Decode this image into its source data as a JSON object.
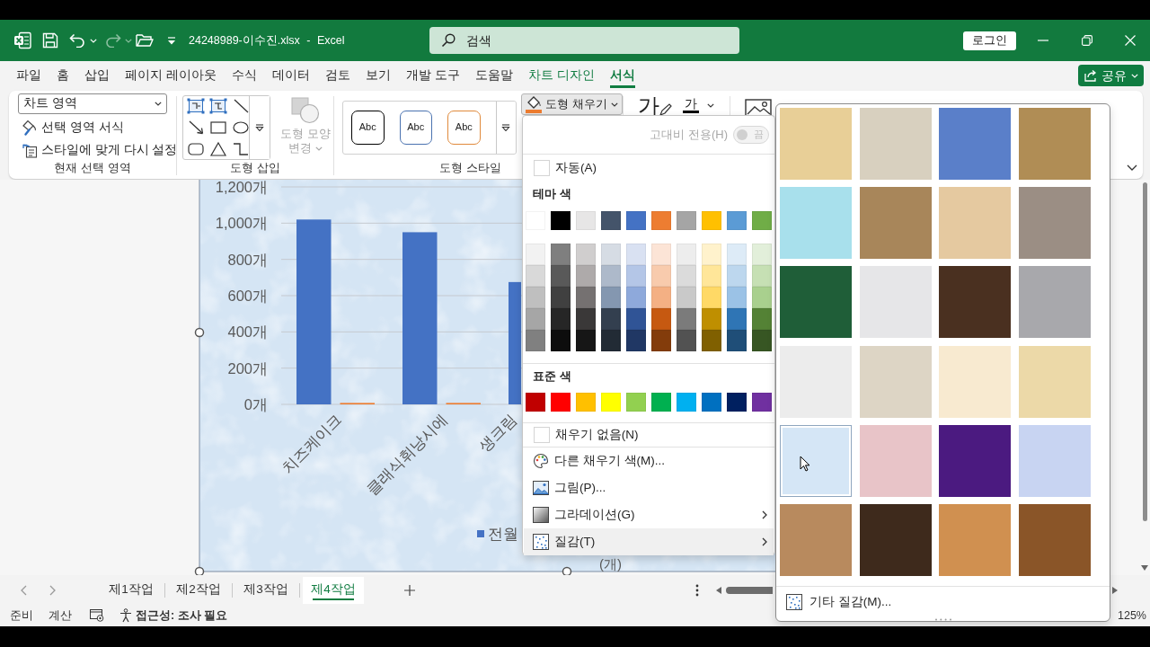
{
  "window": {
    "title": "24248989-이수진.xlsx - Excel",
    "search": {
      "placeholder": "검색"
    },
    "sign_in": "로그인"
  },
  "tabs": [
    {
      "label": "파일",
      "contextual": false,
      "selected": false
    },
    {
      "label": "홈",
      "contextual": false,
      "selected": false
    },
    {
      "label": "삽입",
      "contextual": false,
      "selected": false
    },
    {
      "label": "페이지 레이아웃",
      "contextual": false,
      "selected": false
    },
    {
      "label": "수식",
      "contextual": false,
      "selected": false
    },
    {
      "label": "데이터",
      "contextual": false,
      "selected": false
    },
    {
      "label": "검토",
      "contextual": false,
      "selected": false
    },
    {
      "label": "보기",
      "contextual": false,
      "selected": false
    },
    {
      "label": "개발 도구",
      "contextual": false,
      "selected": false
    },
    {
      "label": "도움말",
      "contextual": false,
      "selected": false
    },
    {
      "label": "차트 디자인",
      "contextual": true,
      "selected": false
    },
    {
      "label": "서식",
      "contextual": true,
      "selected": true
    }
  ],
  "share": "공유",
  "ribbon": {
    "current_selection": {
      "dropdown": "차트 영역",
      "buttons": [
        {
          "kind": "format",
          "label": "선택 영역 서식"
        },
        {
          "kind": "reset",
          "label": "스타일에 맞게 다시 설정"
        }
      ],
      "label": "현재 선택 영역"
    },
    "insert_shapes": {
      "change_shape": {
        "label": "도형 모양 변경",
        "disabled": true
      },
      "label": "도형 삽입"
    },
    "shape_styles": {
      "presets": [
        {
          "text": "Abc",
          "color": "#000000"
        },
        {
          "text": "Abc",
          "color": "#4a72b0"
        },
        {
          "text": "Abc",
          "color": "#e08a3c"
        }
      ],
      "label": "도형 스타일"
    },
    "shape_fill": {
      "label": "도형 채우기",
      "expanded": true
    },
    "wordart": {
      "quick_styles": "가",
      "text_fill": "가"
    }
  },
  "chart": {
    "chart_data": {
      "type": "bar",
      "categories": [
        "치즈케이크",
        "클래식휘낭시에",
        "생크림"
      ],
      "series": [
        {
          "name": "전월",
          "color": "#4472c4",
          "values": [
            1020,
            950,
            675
          ]
        },
        {
          "color": "#ed7d31",
          "values": [
            8,
            8,
            null
          ]
        }
      ],
      "ylim": [
        0,
        1200
      ],
      "yticks": [
        {
          "value": 0,
          "label": "0개"
        },
        {
          "value": 200,
          "label": "200개"
        },
        {
          "value": 400,
          "label": "400개"
        },
        {
          "value": 600,
          "label": "600개"
        },
        {
          "value": 800,
          "label": "800개"
        },
        {
          "value": 1000,
          "label": "1,000개"
        },
        {
          "value": 1200,
          "label": "1,200개"
        }
      ],
      "grid": true
    },
    "unit_label": "(개)"
  },
  "fill_menu": {
    "high_contrast": {
      "label": "고대비 전용(H)",
      "state_text": "끔",
      "on": false,
      "disabled": true
    },
    "automatic": "자동(A)",
    "theme_label": "테마 색",
    "theme_colors": [
      {
        "color": "#ffffff",
        "shades": [
          {
            "color": "#f2f2f2"
          },
          {
            "color": "#d9d9d9"
          },
          {
            "color": "#bfbfbf"
          },
          {
            "color": "#a6a6a6"
          },
          {
            "color": "#808080"
          }
        ]
      },
      {
        "color": "#000000",
        "shades": [
          {
            "color": "#7f7f7f"
          },
          {
            "color": "#595959"
          },
          {
            "color": "#404040"
          },
          {
            "color": "#262626"
          },
          {
            "color": "#0d0d0d"
          }
        ]
      },
      {
        "color": "#e7e6e6",
        "shades": [
          {
            "color": "#d0cece"
          },
          {
            "color": "#aeaaaa"
          },
          {
            "color": "#757171"
          },
          {
            "color": "#3a3838"
          },
          {
            "color": "#161616"
          }
        ]
      },
      {
        "color": "#44546a",
        "shades": [
          {
            "color": "#d6dce4"
          },
          {
            "color": "#adb9ca"
          },
          {
            "color": "#8497b0"
          },
          {
            "color": "#333f4f"
          },
          {
            "color": "#222b35"
          }
        ]
      },
      {
        "color": "#4472c4",
        "shades": [
          {
            "color": "#d9e1f2"
          },
          {
            "color": "#b4c6e7"
          },
          {
            "color": "#8ea9db"
          },
          {
            "color": "#305496"
          },
          {
            "color": "#203764"
          }
        ]
      },
      {
        "color": "#ed7d31",
        "shades": [
          {
            "color": "#fce4d6"
          },
          {
            "color": "#f8cbad"
          },
          {
            "color": "#f4b084"
          },
          {
            "color": "#c65911"
          },
          {
            "color": "#833c0b"
          }
        ]
      },
      {
        "color": "#a5a5a5",
        "shades": [
          {
            "color": "#ededed"
          },
          {
            "color": "#dbdbdb"
          },
          {
            "color": "#c9c9c9"
          },
          {
            "color": "#7b7b7b"
          },
          {
            "color": "#525252"
          }
        ]
      },
      {
        "color": "#ffc000",
        "shades": [
          {
            "color": "#fff2cc"
          },
          {
            "color": "#ffe699"
          },
          {
            "color": "#ffd966"
          },
          {
            "color": "#bf8f00"
          },
          {
            "color": "#806000"
          }
        ]
      },
      {
        "color": "#5b9bd5",
        "shades": [
          {
            "color": "#ddebf7"
          },
          {
            "color": "#bdd7ee"
          },
          {
            "color": "#9bc2e6"
          },
          {
            "color": "#2f75b5"
          },
          {
            "color": "#1f4e78"
          }
        ]
      },
      {
        "color": "#70ad47",
        "shades": [
          {
            "color": "#e2efda"
          },
          {
            "color": "#c6e0b4"
          },
          {
            "color": "#a9d08e"
          },
          {
            "color": "#548235"
          },
          {
            "color": "#375623"
          }
        ]
      }
    ],
    "standard_label": "표준 색",
    "standard_colors": [
      {
        "color": "#c00000"
      },
      {
        "color": "#ff0000"
      },
      {
        "color": "#ffc000"
      },
      {
        "color": "#ffff00"
      },
      {
        "color": "#92d050"
      },
      {
        "color": "#00b050"
      },
      {
        "color": "#00b0f0"
      },
      {
        "color": "#0070c0"
      },
      {
        "color": "#002060"
      },
      {
        "color": "#7030a0"
      }
    ],
    "items": [
      {
        "kind": "no_fill",
        "label": "채우기 없음(N)",
        "submenu": false,
        "selected": false
      },
      {
        "kind": "more_colors",
        "label": "다른 채우기 색(M)...",
        "submenu": false,
        "selected": false
      },
      {
        "kind": "picture",
        "label": "그림(P)...",
        "submenu": false,
        "selected": false
      },
      {
        "kind": "gradient",
        "label": "그라데이션(G)",
        "submenu": true,
        "selected": false
      },
      {
        "kind": "texture",
        "label": "질감(T)",
        "submenu": true,
        "selected": true
      }
    ]
  },
  "texture_gallery": {
    "tiles": [
      {
        "color": "#e8cf97",
        "selected": false
      },
      {
        "color": "#d8d0bf",
        "selected": false
      },
      {
        "color": "#5a7fc9",
        "selected": false
      },
      {
        "color": "#b08d55",
        "selected": false
      },
      {
        "color": "#a8e0ec",
        "selected": false
      },
      {
        "color": "#a8865a",
        "selected": false
      },
      {
        "color": "#e5c9a0",
        "selected": false
      },
      {
        "color": "#9b8e84",
        "selected": false
      },
      {
        "color": "#1f5e38",
        "selected": false
      },
      {
        "color": "#e6e6e8",
        "selected": false
      },
      {
        "color": "#4a3020",
        "selected": false
      },
      {
        "color": "#a8a8ac",
        "selected": false
      },
      {
        "color": "#ececec",
        "selected": false
      },
      {
        "color": "#ddd5c5",
        "selected": false
      },
      {
        "color": "#f8ead0",
        "selected": false
      },
      {
        "color": "#ecd9a8",
        "selected": false
      },
      {
        "color": "#d5e6f6",
        "selected": true
      },
      {
        "color": "#e8c4c8",
        "selected": false
      },
      {
        "color": "#4b1a80",
        "selected": false
      },
      {
        "color": "#c8d4f2",
        "selected": false
      },
      {
        "color": "#b88a5e",
        "selected": false
      },
      {
        "color": "#3e2a1c",
        "selected": false
      },
      {
        "color": "#d09050",
        "selected": false
      },
      {
        "color": "#8a5528",
        "selected": false
      }
    ],
    "more": "기타 질감(M)..."
  },
  "sheet_tabs": [
    {
      "label": "제1작업",
      "selected": false
    },
    {
      "label": "제2작업",
      "selected": false
    },
    {
      "label": "제3작업",
      "selected": false
    },
    {
      "label": "제4작업",
      "selected": true
    }
  ],
  "status_bar": {
    "mode": "준비",
    "calculate": "계산",
    "accessibility": "접근성: 조사 필요",
    "zoom": "125%"
  }
}
